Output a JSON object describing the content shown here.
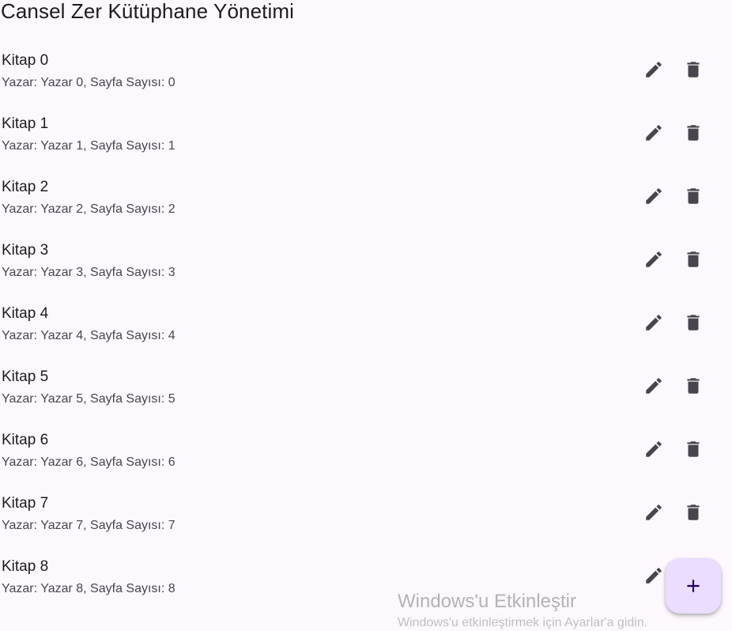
{
  "app": {
    "title": "Cansel Zer Kütüphane Yönetimi"
  },
  "books": [
    {
      "title": "Kitap 0",
      "subtitle": "Yazar: Yazar 0, Sayfa Sayısı: 0"
    },
    {
      "title": "Kitap 1",
      "subtitle": "Yazar: Yazar 1, Sayfa Sayısı: 1"
    },
    {
      "title": "Kitap 2",
      "subtitle": "Yazar: Yazar 2, Sayfa Sayısı: 2"
    },
    {
      "title": "Kitap 3",
      "subtitle": "Yazar: Yazar 3, Sayfa Sayısı: 3"
    },
    {
      "title": "Kitap 4",
      "subtitle": "Yazar: Yazar 4, Sayfa Sayısı: 4"
    },
    {
      "title": "Kitap 5",
      "subtitle": "Yazar: Yazar 5, Sayfa Sayısı: 5"
    },
    {
      "title": "Kitap 6",
      "subtitle": "Yazar: Yazar 6, Sayfa Sayısı: 6"
    },
    {
      "title": "Kitap 7",
      "subtitle": "Yazar: Yazar 7, Sayfa Sayısı: 7"
    },
    {
      "title": "Kitap 8",
      "subtitle": "Yazar: Yazar 8, Sayfa Sayısı: 8"
    }
  ],
  "icons": {
    "edit": "pencil-icon",
    "delete": "trash-icon",
    "add": "plus-icon"
  },
  "watermark": {
    "title": "Windows'u Etkinleştir",
    "subtitle": "Windows'u etkinleştirmek için Ayarlar'a gidin."
  },
  "colors": {
    "background": "#fdf8fd",
    "fab_background": "#eaddff",
    "fab_icon": "#21005d",
    "icon": "#49454f"
  }
}
